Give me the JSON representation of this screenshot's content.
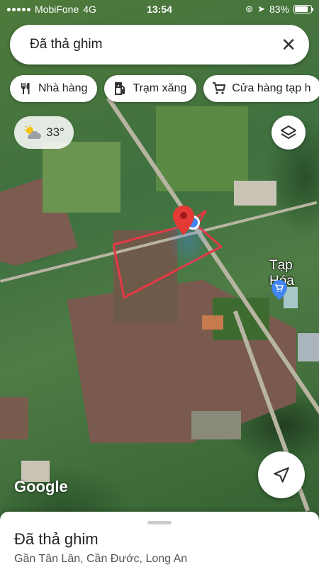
{
  "status_bar": {
    "carrier": "MobiFone",
    "network": "4G",
    "time": "13:54",
    "battery": "83%",
    "battery_level": 0.83
  },
  "search": {
    "text": "Đã thả ghim",
    "close_icon": "close-icon"
  },
  "chips": [
    {
      "label": "Nhà hàng",
      "icon": "restaurant-icon"
    },
    {
      "label": "Trạm xăng",
      "icon": "gas-station-icon"
    },
    {
      "label": "Cửa hàng tạp h",
      "icon": "cart-icon"
    }
  ],
  "weather": {
    "temperature": "33°",
    "icon": "partly-cloudy-icon"
  },
  "map": {
    "place_label": "Tạp Hóa",
    "attribution": "Google",
    "pin_color": "#e53935",
    "boundary_color": "#e53945",
    "shop_pin_color": "#4285f4"
  },
  "sheet": {
    "title": "Đã thả ghim",
    "subtitle": "Gần Tân Lân, Cần Đước, Long An"
  }
}
